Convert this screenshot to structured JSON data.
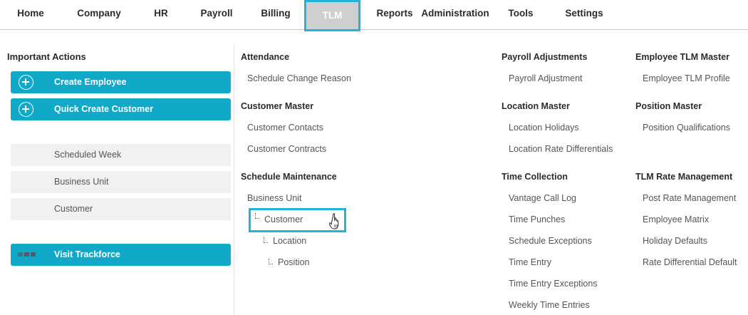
{
  "nav": {
    "items": [
      {
        "label": "Home"
      },
      {
        "label": "Company"
      },
      {
        "label": "HR"
      },
      {
        "label": "Payroll"
      },
      {
        "label": "Billing"
      },
      {
        "label": "TLM",
        "active": true
      },
      {
        "label": "Reports"
      },
      {
        "label": "Administration"
      },
      {
        "label": "Tools"
      },
      {
        "label": "Settings"
      }
    ]
  },
  "left_panel": {
    "title": "Important Actions",
    "buttons": [
      {
        "label": "Create Employee",
        "icon": "plus-circle-icon"
      },
      {
        "label": "Quick Create Customer",
        "icon": "plus-circle-icon"
      }
    ],
    "shortcuts": [
      {
        "label": "Scheduled Week"
      },
      {
        "label": "Business Unit"
      },
      {
        "label": "Customer"
      }
    ],
    "visit_button": {
      "label": "Visit Trackforce",
      "icon": "trackforce-logo-icon"
    }
  },
  "menu": {
    "attendance": {
      "heading": "Attendance",
      "items": [
        "Schedule Change Reason"
      ]
    },
    "customer_master": {
      "heading": "Customer Master",
      "items": [
        "Customer Contacts",
        "Customer Contracts"
      ]
    },
    "schedule_maintenance": {
      "heading": "Schedule Maintenance",
      "items": [
        "Business Unit",
        "Customer",
        "Location",
        "Position"
      ]
    },
    "payroll_adjustments": {
      "heading": "Payroll Adjustments",
      "items": [
        "Payroll Adjustment"
      ]
    },
    "location_master": {
      "heading": "Location Master",
      "items": [
        "Location Holidays",
        "Location Rate Differentials"
      ]
    },
    "time_collection": {
      "heading": "Time Collection",
      "items": [
        "Vantage Call Log",
        "Time Punches",
        "Schedule Exceptions",
        "Time Entry",
        "Time Entry Exceptions",
        "Weekly Time Entries"
      ]
    },
    "employee_tlm_master": {
      "heading": "Employee TLM Master",
      "items": [
        "Employee TLM Profile"
      ]
    },
    "position_master": {
      "heading": "Position Master",
      "items": [
        "Position Qualifications"
      ]
    },
    "tlm_rate_management": {
      "heading": "TLM Rate Management",
      "items": [
        "Post Rate Management",
        "Employee Matrix",
        "Holiday Defaults",
        "Rate Differential Default"
      ]
    }
  },
  "colors": {
    "accent": "#10a9c8",
    "highlight": "#1fb4d8",
    "active_tab_bg": "#cfcfcf"
  }
}
